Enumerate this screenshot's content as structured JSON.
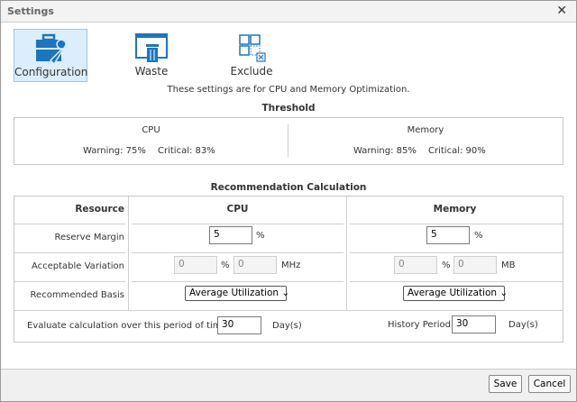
{
  "window": {
    "title": "Settings",
    "close": "✕"
  },
  "toolbar": [
    {
      "label": "Configuration",
      "icon": "toolbox-wrench-icon",
      "selected": true
    },
    {
      "label": "Waste",
      "icon": "trash-window-icon"
    },
    {
      "label": "Exclude",
      "icon": "grid-exclude-icon"
    }
  ],
  "subtitle": "These settings are for CPU and Memory Optimization.",
  "threshold": {
    "heading": "Threshold",
    "cpu": {
      "title": "CPU",
      "warning": "Warning: 75%",
      "critical": "Critical: 83%"
    },
    "memory": {
      "title": "Memory",
      "warning": "Warning: 85%",
      "critical": "Critical: 90%"
    }
  },
  "rec": {
    "heading": "Recommendation Calculation",
    "col_resource": "Resource",
    "col_cpu": "CPU",
    "col_memory": "Memory",
    "reserve_label": "Reserve Margin",
    "variation_label": "Acceptable Variation",
    "basis_label": "Recommended Basis",
    "cpu": {
      "reserve": "5",
      "pct": "%",
      "var_pct": "0",
      "var_abs": "0",
      "unit": "MHz",
      "basis": "Average Utilization"
    },
    "memory": {
      "reserve": "5",
      "pct": "%",
      "var_pct": "0",
      "var_abs": "0",
      "unit": "MB",
      "basis": "Average Utilization"
    },
    "evaluate_label": "Evaluate calculation over this period of time",
    "evaluate_value": "30",
    "days": "Day(s)",
    "history_label": "History Period",
    "history_value": "30"
  },
  "footer": {
    "save": "Save",
    "cancel": "Cancel"
  }
}
